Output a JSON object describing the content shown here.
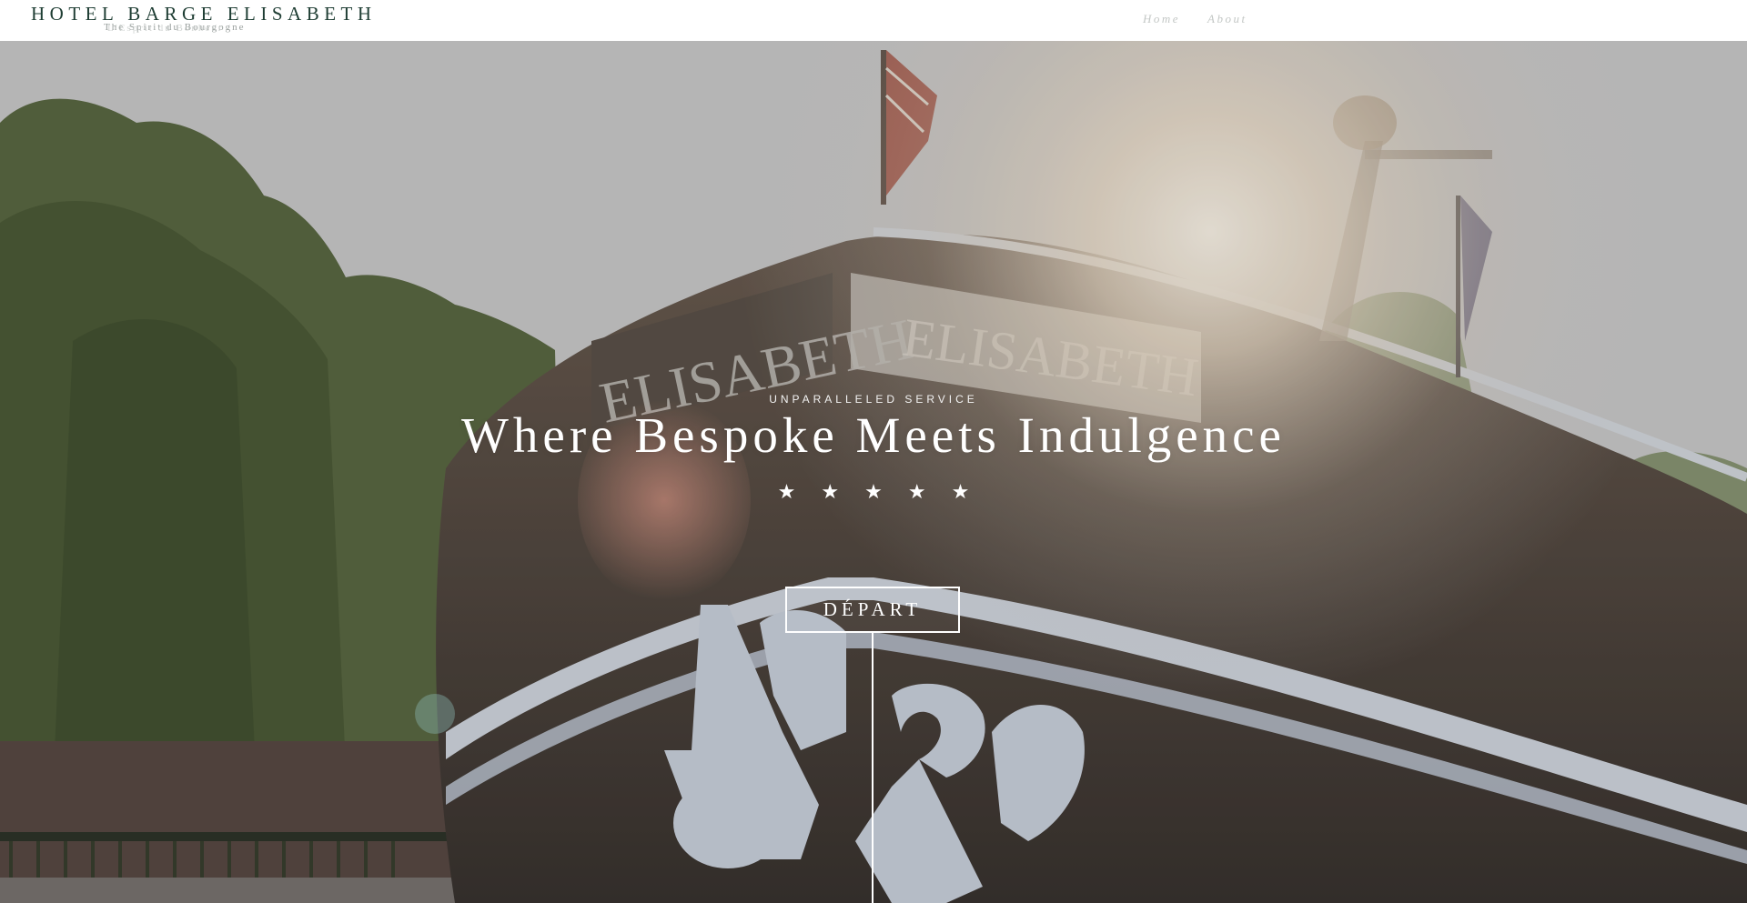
{
  "brand": {
    "title": "HOTEL BARGE ELISABETH",
    "tagline": "The Spirit du Bourgogne",
    "tagline_overlay": "L'Esprit du Bonheur"
  },
  "nav": {
    "items": [
      {
        "label": "Home"
      },
      {
        "label": "About"
      }
    ]
  },
  "hero": {
    "eyebrow": "UNPARALLELED SERVICE",
    "headline": "Where Bespoke Meets Indulgence",
    "rating": 5,
    "star_glyph": "★",
    "cta_label": "DÉPART",
    "boat_name": "ELISABETH"
  },
  "colors": {
    "brand": "#1e3d33",
    "sky": "#cfcfcf",
    "hull": "#4a4038",
    "trim": "#c9d0dc"
  }
}
